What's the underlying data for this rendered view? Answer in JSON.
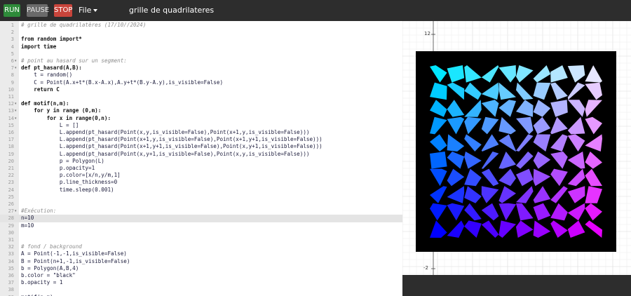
{
  "toolbar": {
    "run_label": "RUN",
    "pause_label": "PAUSE",
    "stop_label": "STOP",
    "file_label": "File",
    "title": "grille de quadrilateres"
  },
  "editor": {
    "active_line": 28,
    "lines": [
      {
        "n": "1",
        "text": "# grille de quadrilatères (17/10//2024)",
        "cls": "comment",
        "fold": ""
      },
      {
        "n": "2",
        "text": "",
        "cls": "",
        "fold": ""
      },
      {
        "n": "3",
        "text": "from random import*",
        "cls": "kw",
        "fold": ""
      },
      {
        "n": "4",
        "text": "import time",
        "cls": "kw",
        "fold": ""
      },
      {
        "n": "5",
        "text": "",
        "cls": "",
        "fold": ""
      },
      {
        "n": "6",
        "text": "# point au hasard sur un segment:",
        "cls": "comment",
        "fold": "▾"
      },
      {
        "n": "7",
        "text": "def pt_hasard(A,B):",
        "cls": "kw",
        "fold": "▾"
      },
      {
        "n": "8",
        "text": "    t = random()",
        "cls": "body",
        "fold": ""
      },
      {
        "n": "9",
        "text": "    C = Point(A.x+t*(B.x-A.x),A.y+t*(B.y-A.y),is_visible=False)",
        "cls": "body",
        "fold": ""
      },
      {
        "n": "10",
        "text": "    return C",
        "cls": "kw",
        "fold": ""
      },
      {
        "n": "11",
        "text": "",
        "cls": "",
        "fold": ""
      },
      {
        "n": "12",
        "text": "def motif(n,m):",
        "cls": "kw",
        "fold": "▾"
      },
      {
        "n": "13",
        "text": "    for y in range (0,m):",
        "cls": "kw",
        "fold": "▾"
      },
      {
        "n": "14",
        "text": "        for x in range(0,n):",
        "cls": "kw",
        "fold": "▾"
      },
      {
        "n": "15",
        "text": "            L = []",
        "cls": "ind2",
        "fold": ""
      },
      {
        "n": "16",
        "text": "            L.append(pt_hasard(Point(x,y,is_visible=False),Point(x+1,y,is_visible=False)))",
        "cls": "ind2",
        "fold": ""
      },
      {
        "n": "17",
        "text": "            L.append(pt_hasard(Point(x+1,y,is_visible=False),Point(x+1,y+1,is_visible=False)))",
        "cls": "ind2",
        "fold": ""
      },
      {
        "n": "18",
        "text": "            L.append(pt_hasard(Point(x+1,y+1,is_visible=False),Point(x,y+1,is_visible=False)))",
        "cls": "ind2",
        "fold": ""
      },
      {
        "n": "19",
        "text": "            L.append(pt_hasard(Point(x,y+1,is_visible=False),Point(x,y,is_visible=False)))",
        "cls": "ind2",
        "fold": ""
      },
      {
        "n": "20",
        "text": "            p = Polygon(L)",
        "cls": "ind2",
        "fold": ""
      },
      {
        "n": "21",
        "text": "            p.opacity=1",
        "cls": "ind2",
        "fold": ""
      },
      {
        "n": "22",
        "text": "            p.color=[x/n,y/m,1]",
        "cls": "ind2",
        "fold": ""
      },
      {
        "n": "23",
        "text": "            p.line_thickness=0",
        "cls": "ind2",
        "fold": ""
      },
      {
        "n": "24",
        "text": "            time.sleep(0.001)",
        "cls": "ind2",
        "fold": ""
      },
      {
        "n": "25",
        "text": "",
        "cls": "",
        "fold": ""
      },
      {
        "n": "26",
        "text": "",
        "cls": "",
        "fold": ""
      },
      {
        "n": "27",
        "text": "#Exécution:",
        "cls": "comment",
        "fold": "▾"
      },
      {
        "n": "28",
        "text": "n=10",
        "cls": "body",
        "fold": ""
      },
      {
        "n": "29",
        "text": "m=10",
        "cls": "body",
        "fold": ""
      },
      {
        "n": "30",
        "text": "",
        "cls": "",
        "fold": ""
      },
      {
        "n": "31",
        "text": "",
        "cls": "",
        "fold": ""
      },
      {
        "n": "32",
        "text": "# fond / background",
        "cls": "comment",
        "fold": ""
      },
      {
        "n": "33",
        "text": "A = Point(-1,-1,is_visible=False)",
        "cls": "body",
        "fold": ""
      },
      {
        "n": "34",
        "text": "B = Point(n+1,-1,is_visible=False)",
        "cls": "body",
        "fold": ""
      },
      {
        "n": "35",
        "text": "b = Polygon(A,B,4)",
        "cls": "body",
        "fold": ""
      },
      {
        "n": "36",
        "text": "b.color = \"black\"",
        "cls": "body",
        "fold": ""
      },
      {
        "n": "37",
        "text": "b.opacity = 1",
        "cls": "body",
        "fold": ""
      },
      {
        "n": "38",
        "text": "",
        "cls": "",
        "fold": ""
      },
      {
        "n": "39",
        "text": "motif(n,m)",
        "cls": "body",
        "fold": ""
      }
    ]
  },
  "graph": {
    "y_tick_top": "12",
    "y_tick_bottom": "-2",
    "background_color": "#000000",
    "grid_n": 10,
    "grid_m": 10
  }
}
